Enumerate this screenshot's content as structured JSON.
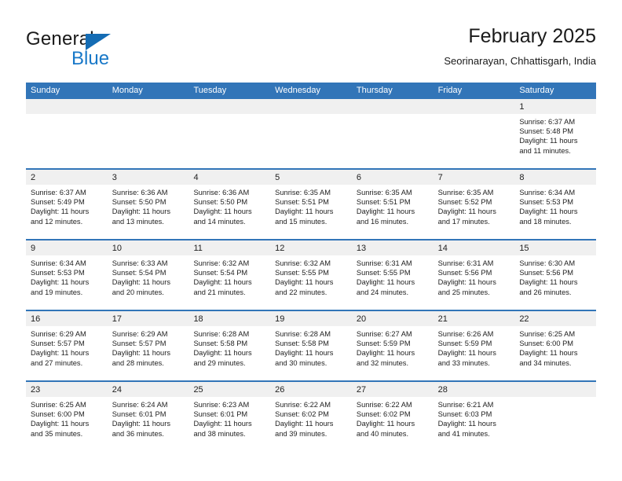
{
  "brand": {
    "name_part1": "General",
    "name_part2": "Blue",
    "triangle_color": "#146cb4",
    "blue_color": "#1878c8"
  },
  "header": {
    "title": "February 2025",
    "subtitle": "Seorinarayan, Chhattisgarh, India"
  },
  "theme": {
    "header_blue": "#3275b8",
    "band_gray": "#f0f0f0",
    "text": "#222222"
  },
  "weekdays": [
    "Sunday",
    "Monday",
    "Tuesday",
    "Wednesday",
    "Thursday",
    "Friday",
    "Saturday"
  ],
  "weeks": [
    [
      {
        "day": "",
        "sunrise": "",
        "sunset": "",
        "daylight1": "",
        "daylight2": ""
      },
      {
        "day": "",
        "sunrise": "",
        "sunset": "",
        "daylight1": "",
        "daylight2": ""
      },
      {
        "day": "",
        "sunrise": "",
        "sunset": "",
        "daylight1": "",
        "daylight2": ""
      },
      {
        "day": "",
        "sunrise": "",
        "sunset": "",
        "daylight1": "",
        "daylight2": ""
      },
      {
        "day": "",
        "sunrise": "",
        "sunset": "",
        "daylight1": "",
        "daylight2": ""
      },
      {
        "day": "",
        "sunrise": "",
        "sunset": "",
        "daylight1": "",
        "daylight2": ""
      },
      {
        "day": "1",
        "sunrise": "Sunrise: 6:37 AM",
        "sunset": "Sunset: 5:48 PM",
        "daylight1": "Daylight: 11 hours",
        "daylight2": "and 11 minutes."
      }
    ],
    [
      {
        "day": "2",
        "sunrise": "Sunrise: 6:37 AM",
        "sunset": "Sunset: 5:49 PM",
        "daylight1": "Daylight: 11 hours",
        "daylight2": "and 12 minutes."
      },
      {
        "day": "3",
        "sunrise": "Sunrise: 6:36 AM",
        "sunset": "Sunset: 5:50 PM",
        "daylight1": "Daylight: 11 hours",
        "daylight2": "and 13 minutes."
      },
      {
        "day": "4",
        "sunrise": "Sunrise: 6:36 AM",
        "sunset": "Sunset: 5:50 PM",
        "daylight1": "Daylight: 11 hours",
        "daylight2": "and 14 minutes."
      },
      {
        "day": "5",
        "sunrise": "Sunrise: 6:35 AM",
        "sunset": "Sunset: 5:51 PM",
        "daylight1": "Daylight: 11 hours",
        "daylight2": "and 15 minutes."
      },
      {
        "day": "6",
        "sunrise": "Sunrise: 6:35 AM",
        "sunset": "Sunset: 5:51 PM",
        "daylight1": "Daylight: 11 hours",
        "daylight2": "and 16 minutes."
      },
      {
        "day": "7",
        "sunrise": "Sunrise: 6:35 AM",
        "sunset": "Sunset: 5:52 PM",
        "daylight1": "Daylight: 11 hours",
        "daylight2": "and 17 minutes."
      },
      {
        "day": "8",
        "sunrise": "Sunrise: 6:34 AM",
        "sunset": "Sunset: 5:53 PM",
        "daylight1": "Daylight: 11 hours",
        "daylight2": "and 18 minutes."
      }
    ],
    [
      {
        "day": "9",
        "sunrise": "Sunrise: 6:34 AM",
        "sunset": "Sunset: 5:53 PM",
        "daylight1": "Daylight: 11 hours",
        "daylight2": "and 19 minutes."
      },
      {
        "day": "10",
        "sunrise": "Sunrise: 6:33 AM",
        "sunset": "Sunset: 5:54 PM",
        "daylight1": "Daylight: 11 hours",
        "daylight2": "and 20 minutes."
      },
      {
        "day": "11",
        "sunrise": "Sunrise: 6:32 AM",
        "sunset": "Sunset: 5:54 PM",
        "daylight1": "Daylight: 11 hours",
        "daylight2": "and 21 minutes."
      },
      {
        "day": "12",
        "sunrise": "Sunrise: 6:32 AM",
        "sunset": "Sunset: 5:55 PM",
        "daylight1": "Daylight: 11 hours",
        "daylight2": "and 22 minutes."
      },
      {
        "day": "13",
        "sunrise": "Sunrise: 6:31 AM",
        "sunset": "Sunset: 5:55 PM",
        "daylight1": "Daylight: 11 hours",
        "daylight2": "and 24 minutes."
      },
      {
        "day": "14",
        "sunrise": "Sunrise: 6:31 AM",
        "sunset": "Sunset: 5:56 PM",
        "daylight1": "Daylight: 11 hours",
        "daylight2": "and 25 minutes."
      },
      {
        "day": "15",
        "sunrise": "Sunrise: 6:30 AM",
        "sunset": "Sunset: 5:56 PM",
        "daylight1": "Daylight: 11 hours",
        "daylight2": "and 26 minutes."
      }
    ],
    [
      {
        "day": "16",
        "sunrise": "Sunrise: 6:29 AM",
        "sunset": "Sunset: 5:57 PM",
        "daylight1": "Daylight: 11 hours",
        "daylight2": "and 27 minutes."
      },
      {
        "day": "17",
        "sunrise": "Sunrise: 6:29 AM",
        "sunset": "Sunset: 5:57 PM",
        "daylight1": "Daylight: 11 hours",
        "daylight2": "and 28 minutes."
      },
      {
        "day": "18",
        "sunrise": "Sunrise: 6:28 AM",
        "sunset": "Sunset: 5:58 PM",
        "daylight1": "Daylight: 11 hours",
        "daylight2": "and 29 minutes."
      },
      {
        "day": "19",
        "sunrise": "Sunrise: 6:28 AM",
        "sunset": "Sunset: 5:58 PM",
        "daylight1": "Daylight: 11 hours",
        "daylight2": "and 30 minutes."
      },
      {
        "day": "20",
        "sunrise": "Sunrise: 6:27 AM",
        "sunset": "Sunset: 5:59 PM",
        "daylight1": "Daylight: 11 hours",
        "daylight2": "and 32 minutes."
      },
      {
        "day": "21",
        "sunrise": "Sunrise: 6:26 AM",
        "sunset": "Sunset: 5:59 PM",
        "daylight1": "Daylight: 11 hours",
        "daylight2": "and 33 minutes."
      },
      {
        "day": "22",
        "sunrise": "Sunrise: 6:25 AM",
        "sunset": "Sunset: 6:00 PM",
        "daylight1": "Daylight: 11 hours",
        "daylight2": "and 34 minutes."
      }
    ],
    [
      {
        "day": "23",
        "sunrise": "Sunrise: 6:25 AM",
        "sunset": "Sunset: 6:00 PM",
        "daylight1": "Daylight: 11 hours",
        "daylight2": "and 35 minutes."
      },
      {
        "day": "24",
        "sunrise": "Sunrise: 6:24 AM",
        "sunset": "Sunset: 6:01 PM",
        "daylight1": "Daylight: 11 hours",
        "daylight2": "and 36 minutes."
      },
      {
        "day": "25",
        "sunrise": "Sunrise: 6:23 AM",
        "sunset": "Sunset: 6:01 PM",
        "daylight1": "Daylight: 11 hours",
        "daylight2": "and 38 minutes."
      },
      {
        "day": "26",
        "sunrise": "Sunrise: 6:22 AM",
        "sunset": "Sunset: 6:02 PM",
        "daylight1": "Daylight: 11 hours",
        "daylight2": "and 39 minutes."
      },
      {
        "day": "27",
        "sunrise": "Sunrise: 6:22 AM",
        "sunset": "Sunset: 6:02 PM",
        "daylight1": "Daylight: 11 hours",
        "daylight2": "and 40 minutes."
      },
      {
        "day": "28",
        "sunrise": "Sunrise: 6:21 AM",
        "sunset": "Sunset: 6:03 PM",
        "daylight1": "Daylight: 11 hours",
        "daylight2": "and 41 minutes."
      },
      {
        "day": "",
        "sunrise": "",
        "sunset": "",
        "daylight1": "",
        "daylight2": ""
      }
    ]
  ]
}
